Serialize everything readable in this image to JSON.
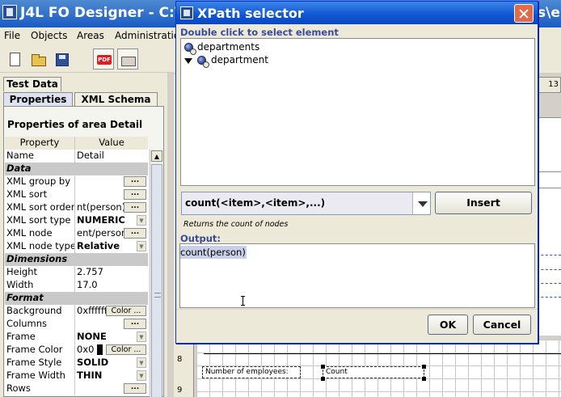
{
  "main_window": {
    "title": "J4L FO Designer - C:\\",
    "title_tail": "s\\e",
    "menu": [
      "File",
      "Objects",
      "Areas",
      "Administratio"
    ]
  },
  "toolbar": {
    "icons": [
      "new-file-icon",
      "open-folder-icon",
      "save-disk-icon",
      "export-pdf-icon",
      "open-template-icon"
    ],
    "pdf_label": "PDF"
  },
  "left_panel": {
    "tabs_top": [
      "Test Data"
    ],
    "tabs": [
      "Properties",
      "XML Schema"
    ],
    "active_tab": "Properties",
    "title": "Properties of area Detail",
    "columns": [
      "Property",
      "Value"
    ],
    "rows": [
      {
        "name": "Name",
        "value": "Detail"
      },
      {
        "section": "Data"
      },
      {
        "name": "XML group by",
        "value": "",
        "button": "..."
      },
      {
        "name": "XML sort",
        "value": "",
        "button": "..."
      },
      {
        "name": "XML sort order",
        "value": "nt(person)",
        "button": "..."
      },
      {
        "name": "XML sort type",
        "value": "NUMERIC",
        "dropdown": true
      },
      {
        "name": "XML node",
        "value": "ent/person",
        "button": "..."
      },
      {
        "name": "XML node type",
        "value": "Relative",
        "dropdown": true
      },
      {
        "section": "Dimensions"
      },
      {
        "name": "Height",
        "value": "2.757"
      },
      {
        "name": "Width",
        "value": "17.0"
      },
      {
        "section": "Format"
      },
      {
        "name": "Background",
        "value": "0xffffff",
        "color_button": "Color ..."
      },
      {
        "name": "Columns",
        "value": "",
        "button": "..."
      },
      {
        "name": "Frame",
        "value": "NONE",
        "dropdown": true
      },
      {
        "name": "Frame Color",
        "value": "0x0",
        "color_button": "Color ...",
        "swatch": "#000000"
      },
      {
        "name": "Frame Style",
        "value": "SOLID",
        "dropdown": true
      },
      {
        "name": "Frame Width",
        "value": "THIN",
        "dropdown": true
      },
      {
        "name": "Rows",
        "value": "",
        "button": "..."
      }
    ]
  },
  "designer": {
    "ruler_marks": [
      "8",
      "9"
    ],
    "ruler_top_right": "13",
    "fields": [
      {
        "label": "Number of employees:"
      },
      {
        "label": "Count"
      }
    ]
  },
  "dialog": {
    "title": "XPath selector",
    "hint": "Double click to select element",
    "tree": [
      {
        "label": "departments",
        "level": 0,
        "expanded": false
      },
      {
        "label": "department",
        "level": 1,
        "expanded": true
      }
    ],
    "function_select": "count(<item>,<item>,...)",
    "insert_label": "Insert",
    "description": "Returns the count of nodes",
    "output_label": "Output:",
    "output_value": "count(person)",
    "ok_label": "OK",
    "cancel_label": "Cancel"
  },
  "colors": {
    "title_bar": "#0f56d2",
    "hint_text": "#3b4a9c",
    "close_button": "#e06a4a",
    "selection": "#c7d0e6"
  }
}
